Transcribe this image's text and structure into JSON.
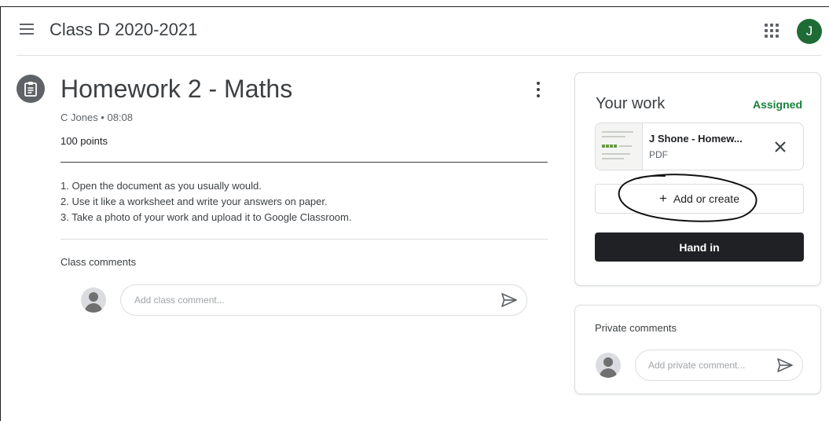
{
  "header": {
    "class_title": "Class D 2020-2021",
    "avatar_initial": "J",
    "avatar_color": "#1e6b35"
  },
  "assignment": {
    "icon": "assignment-icon",
    "title": "Homework 2 - Maths",
    "meta": "C Jones • 08:08",
    "points": "100 points",
    "instructions": [
      "1. Open the document as you usually would.",
      "2. Use it like a worksheet and write your answers on paper.",
      "3. Take a photo of your work and upload it to Google Classroom."
    ]
  },
  "class_comments": {
    "label": "Class comments",
    "placeholder": "Add class comment..."
  },
  "your_work": {
    "title": "Your work",
    "status": "Assigned",
    "status_color": "#188038",
    "attachment": {
      "name": "J Shone - Homew...",
      "type": "PDF"
    },
    "add_label": "Add or create",
    "hand_in_label": "Hand in"
  },
  "private_comments": {
    "label": "Private comments",
    "placeholder": "Add private comment..."
  }
}
